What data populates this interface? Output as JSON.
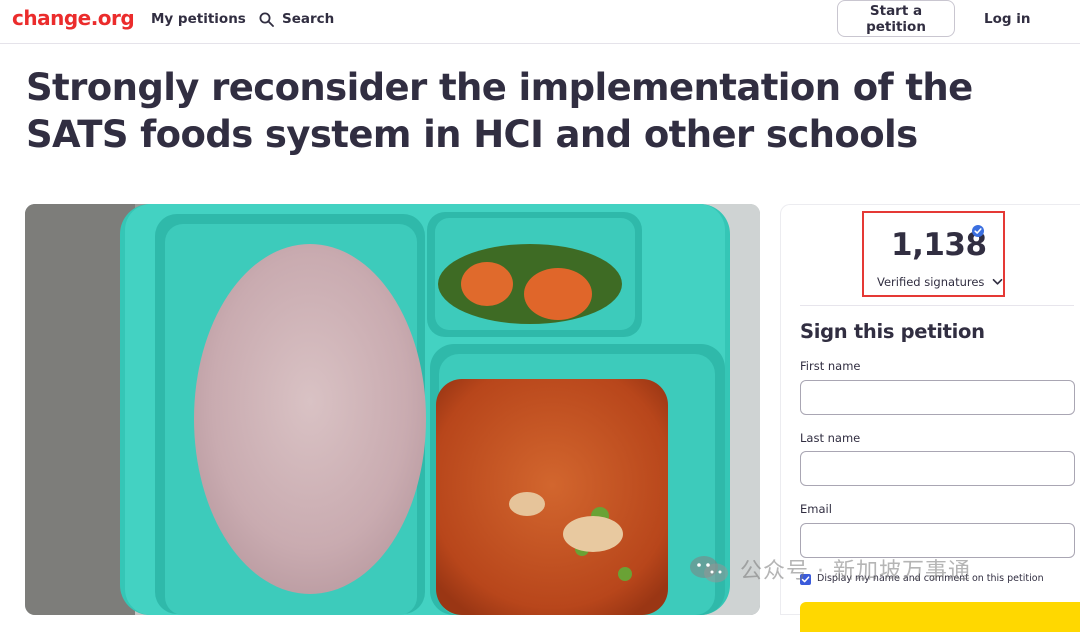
{
  "nav": {
    "logo": "change.org",
    "my_petitions": "My petitions",
    "search_label": "Search",
    "start_petition": "Start a petition",
    "login": "Log in"
  },
  "petition": {
    "title": "Strongly reconsider the implementation of the SATS foods system in HCI and other schools",
    "photo_icon": "school-meal-tray-photo"
  },
  "signatures": {
    "count": "1,138",
    "label": "Verified signatures",
    "verified_icon": "verified-badge-icon",
    "dropdown_icon": "chevron-down-icon"
  },
  "sign_form": {
    "heading": "Sign this petition",
    "first_name_label": "First name",
    "first_name_value": "",
    "last_name_label": "Last name",
    "last_name_value": "",
    "email_label": "Email",
    "email_value": "",
    "consent_label": "Display my name and comment on this petition",
    "consent_checked": true,
    "sign_button_color": "#ffd800"
  },
  "watermark": {
    "text": "公众号 · 新加坡万事通"
  },
  "colors": {
    "brand_red": "#eb2c2c",
    "text_dark": "#312e41",
    "highlight_red": "#e53935",
    "verified_blue": "#3b6fe0",
    "tray_teal": "#3fcfbf"
  }
}
